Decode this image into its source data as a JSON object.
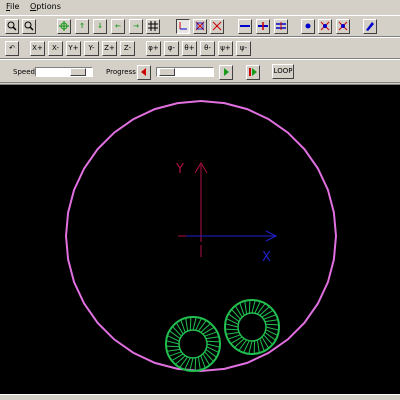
{
  "menu": [
    {
      "label": "File",
      "hotkey": "F",
      "rest": "ile"
    },
    {
      "label": "Options",
      "hotkey": "O",
      "rest": "ptions"
    }
  ],
  "toolbar1": {
    "zoom_in_icon": "zoom-in-icon",
    "zoom_out_icon": "zoom-out-icon",
    "pan_icon": "pan-all-icon",
    "up_label": "↑",
    "down_label": "↓",
    "left_label": "←",
    "right_label": "→"
  },
  "toolbar2": {
    "reset_label": "↶",
    "x_plus": "X+",
    "x_minus": "X-",
    "y_plus": "Y+",
    "y_minus": "Y-",
    "z_plus": "Z+",
    "z_minus": "Z-",
    "phi_plus": "φ+",
    "phi_minus": "φ-",
    "theta_plus": "θ+",
    "theta_minus": "θ-",
    "psi_plus": "ψ+",
    "psi_minus": "ψ-"
  },
  "controls": {
    "speed_label": "Speed",
    "progress_label": "Progress",
    "speed_level": 0.85,
    "progress_level": 0.05,
    "loop_label": "LOOP"
  },
  "scene": {
    "axis_y_label": "Y",
    "axis_x_label": "X",
    "colors": {
      "circle": "#e070e0",
      "x_axis": "#2020d0",
      "y_axis": "#b01040",
      "wheels": "#20c050",
      "background": "#000000"
    }
  },
  "status": {
    "text": ""
  }
}
